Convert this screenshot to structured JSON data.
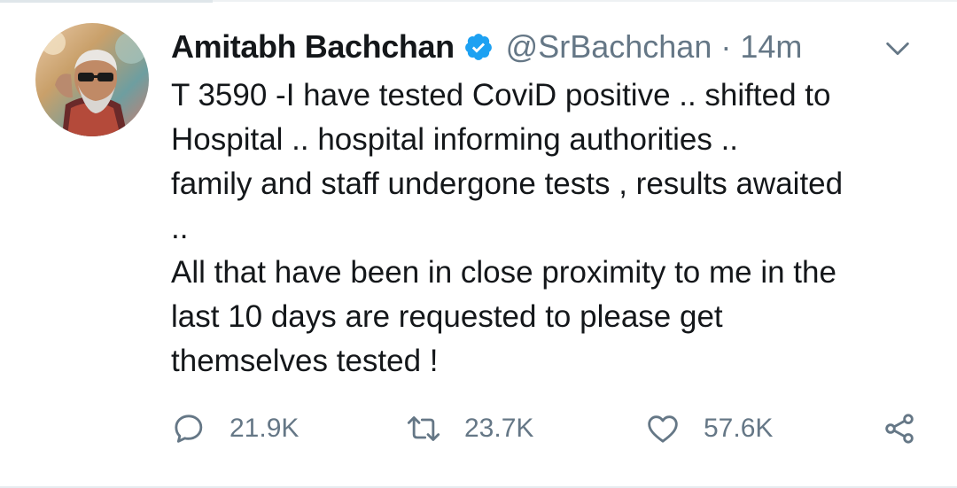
{
  "tweet": {
    "author": {
      "display_name": "Amitabh Bachchan",
      "handle": "@SrBachchan",
      "separator": "·",
      "time": "14m"
    },
    "text": "T 3590 -I have tested CoviD positive ..  shifted to\nHospital  .. hospital informing  authorities ..\nfamily and staff undergone tests , results awaited\n..\nAll that have been in close proximity to me in the\nlast 10 days are requested to please get\nthemselves tested !",
    "actions": {
      "reply": {
        "icon": "reply-icon",
        "count": "21.9K"
      },
      "retweet": {
        "icon": "retweet-icon",
        "count": "23.7K"
      },
      "like": {
        "icon": "heart-icon",
        "count": "57.6K"
      },
      "share": {
        "icon": "share-icon"
      }
    },
    "colors": {
      "name": "#14171a",
      "secondary": "#657786",
      "verified": "#1da1f2"
    }
  }
}
